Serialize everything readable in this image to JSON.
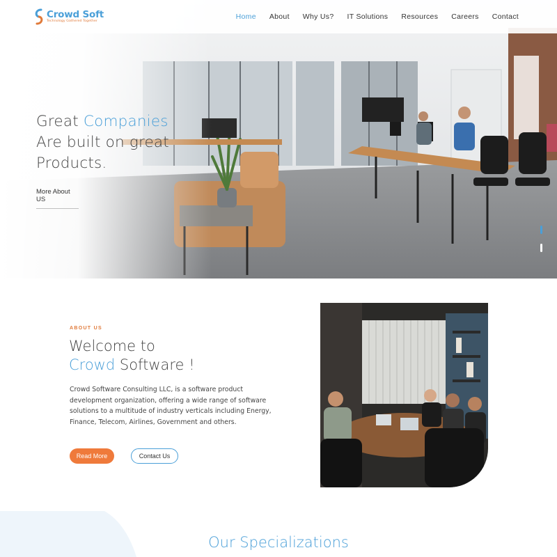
{
  "brand": {
    "name": "Crowd Soft",
    "tagline": "Technology Gathered Together",
    "primary_color": "#4a9fd8",
    "accent_color": "#ef7a3b"
  },
  "nav": {
    "items": [
      {
        "label": "Home",
        "active": true
      },
      {
        "label": "About",
        "active": false
      },
      {
        "label": "Why Us?",
        "active": false
      },
      {
        "label": "IT Solutions",
        "active": false
      },
      {
        "label": "Resources",
        "active": false
      },
      {
        "label": "Careers",
        "active": false
      },
      {
        "label": "Contact",
        "active": false
      }
    ]
  },
  "hero": {
    "line1_a": "Great ",
    "line1_b": "Companies",
    "line2": "Are built on great",
    "line3": "Products.",
    "link": "More About US",
    "slides_total": 2,
    "active_slide": 1
  },
  "about": {
    "eyebrow": "ABOUT US",
    "title_line1": "Welcome to",
    "title_accent": "Crowd",
    "title_rest": " Software !",
    "body": "Crowd Software Consulting LLC, is a software product development organization, offering a wide range of software solutions to a multitude of industry verticals including Energy, Finance, Telecom, Airlines, Government and others.",
    "read_more": "Read More",
    "contact": "Contact Us"
  },
  "specializations": {
    "title": "Our Specializations"
  }
}
